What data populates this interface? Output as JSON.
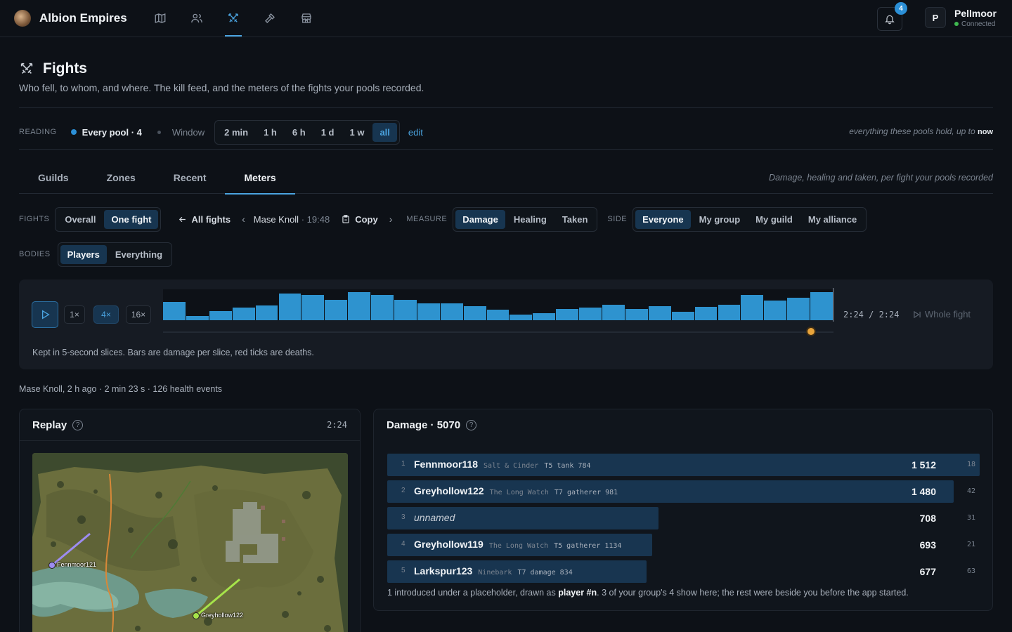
{
  "app": {
    "name": "Albion Empires"
  },
  "nav": {
    "icons": [
      "map-icon",
      "users-icon",
      "swords-icon",
      "hammer-icon",
      "store-icon"
    ],
    "active": "swords-icon"
  },
  "notifications": {
    "count": "4"
  },
  "user": {
    "initial": "P",
    "name": "Pellmoor",
    "status": "Connected"
  },
  "page": {
    "title": "Fights",
    "subtitle": "Who fell, to whom, and where. The kill feed, and the meters of the fights your pools recorded."
  },
  "reading": {
    "label": "READING",
    "pool": "Every pool · 4",
    "window_label": "Window",
    "windows": [
      "2 min",
      "1 h",
      "6 h",
      "1 d",
      "1 w",
      "all"
    ],
    "selected_window": "all",
    "edit": "edit",
    "note": "everything these pools hold, up to",
    "note_strong": "now"
  },
  "tabs": {
    "items": [
      "Guilds",
      "Zones",
      "Recent",
      "Meters"
    ],
    "active": "Meters",
    "note": "Damage, healing and taken, per fight your pools recorded"
  },
  "controls": {
    "fights_label": "FIGHTS",
    "fights_options": [
      "Overall",
      "One fight"
    ],
    "fights_selected": "One fight",
    "all_fights": "All fights",
    "fight_name": "Mase Knoll",
    "fight_time": "· 19:48",
    "copy": "Copy",
    "measure_label": "MEASURE",
    "measure_options": [
      "Damage",
      "Healing",
      "Taken"
    ],
    "measure_selected": "Damage",
    "side_label": "SIDE",
    "side_options": [
      "Everyone",
      "My group",
      "My guild",
      "My alliance"
    ],
    "side_selected": "Everyone",
    "bodies_label": "BODIES",
    "bodies_options": [
      "Players",
      "Everything"
    ],
    "bodies_selected": "Players"
  },
  "timeline": {
    "speeds": [
      "1×",
      "4×",
      "16×"
    ],
    "speed_selected": "4×",
    "time": "2:24 / 2:24",
    "whole_fight": "Whole fight",
    "note": "Kept in 5-second slices. Bars are damage per slice, red ticks are deaths.",
    "slices": [
      26,
      6,
      13,
      18,
      21,
      38,
      36,
      29,
      40,
      36,
      29,
      24,
      24,
      20,
      15,
      8,
      10,
      16,
      18,
      22,
      16,
      20,
      12,
      19,
      22,
      36,
      28,
      32,
      40
    ],
    "position_fraction": 0.966
  },
  "fight_meta": "Mase Knoll, 2 h ago · 2 min 23 s · 126 health events",
  "replay": {
    "title": "Replay",
    "time": "2:24",
    "markers": [
      {
        "name": "Fennmoor121",
        "color": "#9d8cf0"
      },
      {
        "name": "Greyhollow122",
        "color": "#a6e34a"
      }
    ]
  },
  "damage": {
    "title": "Damage · 5070",
    "max": 1512,
    "rows": [
      {
        "rank": "1",
        "name": "Fennmoor118",
        "guild": "Salt & Cinder",
        "info": "T5 tank 784",
        "value": "1 512",
        "raw": 1512,
        "count": "18",
        "italic": false
      },
      {
        "rank": "2",
        "name": "Greyhollow122",
        "guild": "The Long Watch",
        "info": "T7 gatherer 981",
        "value": "1 480",
        "raw": 1480,
        "count": "42",
        "italic": false
      },
      {
        "rank": "3",
        "name": "unnamed",
        "guild": "",
        "info": "",
        "value": "708",
        "raw": 708,
        "count": "31",
        "italic": true
      },
      {
        "rank": "4",
        "name": "Greyhollow119",
        "guild": "The Long Watch",
        "info": "T5 gatherer 1134",
        "value": "693",
        "raw": 693,
        "count": "21",
        "italic": false
      },
      {
        "rank": "5",
        "name": "Larkspur123",
        "guild": "Ninebark",
        "info": "T7 damage 834",
        "value": "677",
        "raw": 677,
        "count": "63",
        "italic": false
      }
    ],
    "note_pre": "1 introduced under a placeholder, drawn as",
    "note_strong": "player #n",
    "note_post": ". 3 of your group's 4 show here; the rest were beside you before the app started."
  }
}
